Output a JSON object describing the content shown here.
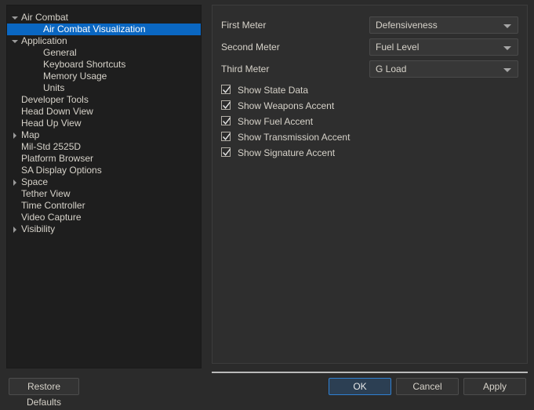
{
  "sidebar": {
    "items": [
      {
        "label": "Air Combat",
        "level": 0,
        "arrow": "expanded",
        "selected": false
      },
      {
        "label": "Air Combat Visualization",
        "level": 1,
        "arrow": "none",
        "selected": true
      },
      {
        "label": "Application",
        "level": 0,
        "arrow": "expanded",
        "selected": false
      },
      {
        "label": "General",
        "level": 1,
        "arrow": "none",
        "selected": false
      },
      {
        "label": "Keyboard Shortcuts",
        "level": 1,
        "arrow": "none",
        "selected": false
      },
      {
        "label": "Memory Usage",
        "level": 1,
        "arrow": "none",
        "selected": false
      },
      {
        "label": "Units",
        "level": 1,
        "arrow": "none",
        "selected": false
      },
      {
        "label": "Developer Tools",
        "level": 0,
        "arrow": "none",
        "selected": false
      },
      {
        "label": "Head Down View",
        "level": 0,
        "arrow": "none",
        "selected": false
      },
      {
        "label": "Head Up View",
        "level": 0,
        "arrow": "none",
        "selected": false
      },
      {
        "label": "Map",
        "level": 0,
        "arrow": "collapsed",
        "selected": false
      },
      {
        "label": "Mil-Std 2525D",
        "level": 0,
        "arrow": "none",
        "selected": false
      },
      {
        "label": "Platform Browser",
        "level": 0,
        "arrow": "none",
        "selected": false
      },
      {
        "label": "SA Display Options",
        "level": 0,
        "arrow": "none",
        "selected": false
      },
      {
        "label": "Space",
        "level": 0,
        "arrow": "collapsed",
        "selected": false
      },
      {
        "label": "Tether View",
        "level": 0,
        "arrow": "none",
        "selected": false
      },
      {
        "label": "Time Controller",
        "level": 0,
        "arrow": "none",
        "selected": false
      },
      {
        "label": "Video Capture",
        "level": 0,
        "arrow": "none",
        "selected": false
      },
      {
        "label": "Visibility",
        "level": 0,
        "arrow": "collapsed",
        "selected": false
      }
    ]
  },
  "options": {
    "combos": [
      {
        "label": "First Meter",
        "value": "Defensiveness",
        "icon": "chevron-down-icon"
      },
      {
        "label": "Second Meter",
        "value": "Fuel Level",
        "icon": "chevron-down-icon"
      },
      {
        "label": "Third Meter",
        "value": "G Load",
        "icon": "chevron-down-icon"
      }
    ],
    "checkboxes": [
      {
        "label": "Show State Data",
        "checked": true
      },
      {
        "label": "Show Weapons Accent",
        "checked": true
      },
      {
        "label": "Show Fuel Accent",
        "checked": true
      },
      {
        "label": "Show Transmission Accent",
        "checked": true
      },
      {
        "label": "Show Signature Accent",
        "checked": true
      }
    ]
  },
  "footer": {
    "restore_defaults_label": "Restore Defaults",
    "ok_label": "OK",
    "cancel_label": "Cancel",
    "apply_label": "Apply"
  },
  "colors": {
    "selection_blue": "#0a67c2",
    "default_button_border": "#2f80d2",
    "window_background": "#2b2b2b",
    "tree_background": "#1e1e1e",
    "panel_background": "#2e2e2e"
  }
}
